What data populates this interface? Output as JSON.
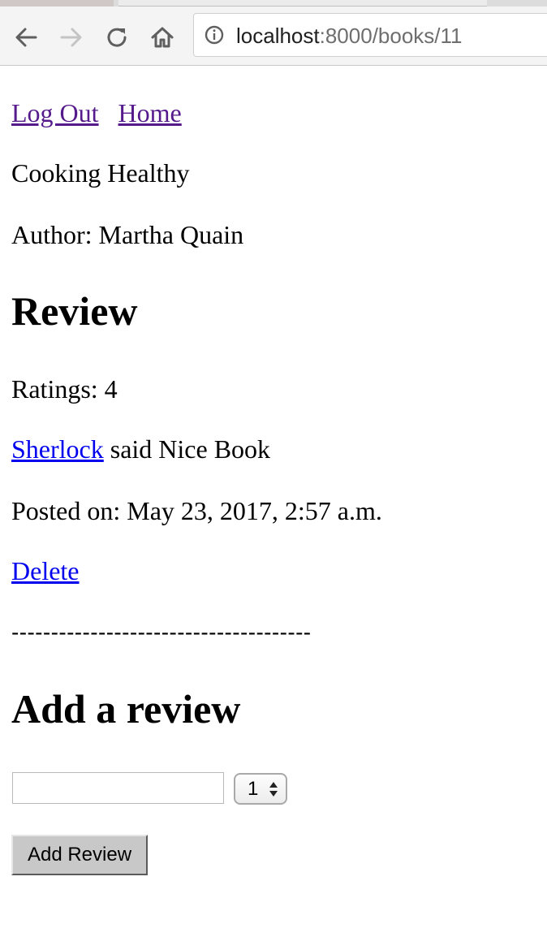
{
  "browser": {
    "url_host": "localhost",
    "url_path": ":8000/books/11"
  },
  "nav": {
    "logout_label": "Log Out",
    "home_label": "Home"
  },
  "book": {
    "title": "Cooking Healthy",
    "author_line": "Author: Martha Quain"
  },
  "reviews": {
    "heading": "Review",
    "items": [
      {
        "ratings_line": "Ratings: 4",
        "user": "Sherlock",
        "said_text": " said Nice Book",
        "posted_line": "Posted on: May 23, 2017, 2:57 a.m.",
        "delete_label": "Delete"
      }
    ],
    "separator": "--------------------------------------"
  },
  "add_review": {
    "heading": "Add a review",
    "review_input_value": "",
    "rating_selected": "1",
    "submit_label": "Add Review"
  },
  "icons": {
    "back": "back-arrow-icon",
    "forward": "forward-arrow-icon",
    "reload": "reload-icon",
    "home": "home-icon",
    "info": "info-icon",
    "select_arrows": "up-down-arrows-icon"
  },
  "colors": {
    "visited_link": "#551a8b",
    "unvisited_link": "#0000ee"
  }
}
